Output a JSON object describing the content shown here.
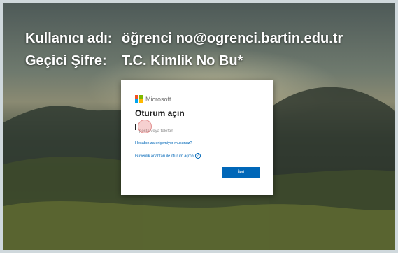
{
  "caption": {
    "username_label": "Kullanıcı adı:",
    "username_value": "öğrenci no@ogrenci.bartin.edu.tr",
    "password_label": "Geçici Şifre:",
    "password_value": "T.C. Kimlik No Bu*"
  },
  "signin": {
    "brand": "Microsoft",
    "title": "Oturum açın",
    "email_placeholder": "posta veya telefon",
    "cant_access_link": "Hesabınıza erişemiyor musunuz?",
    "security_key_link": "Güvenlik anahtarı ile oturum açma",
    "help_symbol": "?",
    "next_button": "İleri"
  },
  "colors": {
    "ms_red": "#f25022",
    "ms_green": "#7fba00",
    "ms_blue": "#00a4ef",
    "ms_yellow": "#ffb900",
    "accent": "#0067b8"
  },
  "icons": [
    "microsoft-logo-icon",
    "help-circle-icon"
  ]
}
